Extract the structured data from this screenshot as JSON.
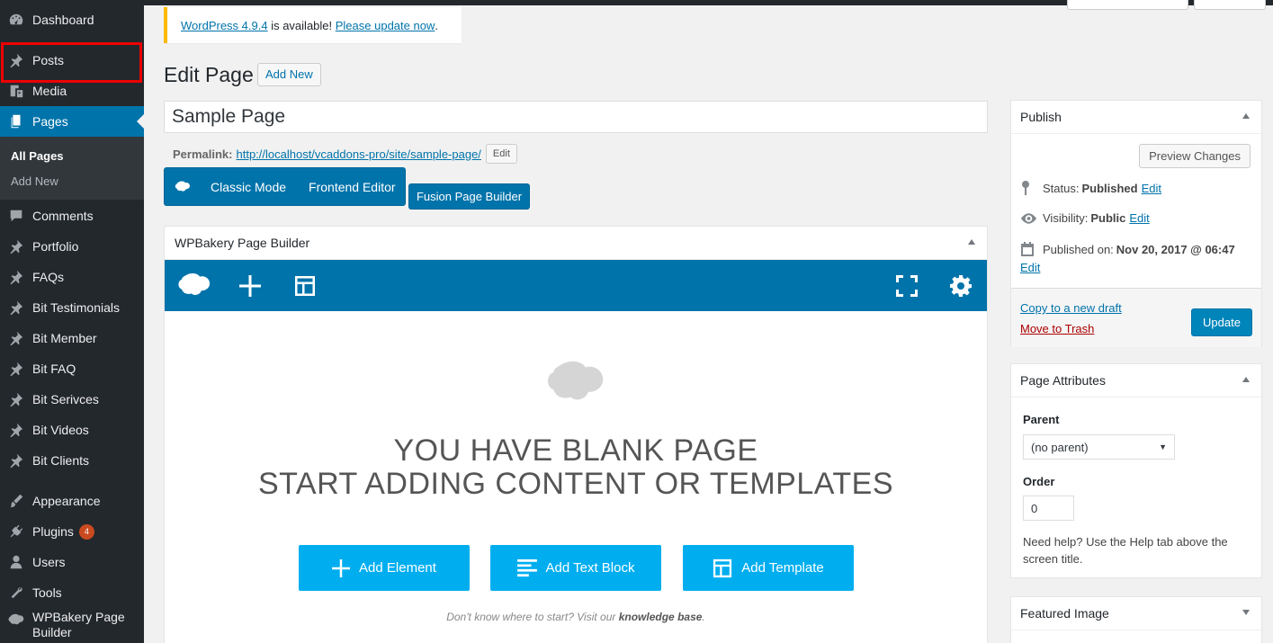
{
  "sidebar": {
    "items": [
      {
        "label": "Dashboard",
        "icon": "dashboard-icon"
      },
      {
        "label": "Posts",
        "icon": "pin-icon"
      },
      {
        "label": "Media",
        "icon": "media-icon"
      },
      {
        "label": "Pages",
        "icon": "pages-icon"
      },
      {
        "label": "Comments",
        "icon": "comments-icon"
      },
      {
        "label": "Portfolio",
        "icon": "pin-icon"
      },
      {
        "label": "FAQs",
        "icon": "pin-icon"
      },
      {
        "label": "Bit Testimonials",
        "icon": "pin-icon"
      },
      {
        "label": "Bit Member",
        "icon": "pin-icon"
      },
      {
        "label": "Bit FAQ",
        "icon": "pin-icon"
      },
      {
        "label": "Bit Serivces",
        "icon": "pin-icon"
      },
      {
        "label": "Bit Videos",
        "icon": "pin-icon"
      },
      {
        "label": "Bit Clients",
        "icon": "pin-icon"
      },
      {
        "label": "Appearance",
        "icon": "appearance-icon"
      },
      {
        "label": "Plugins",
        "icon": "plugins-icon",
        "badge": "4"
      },
      {
        "label": "Users",
        "icon": "users-icon"
      },
      {
        "label": "Tools",
        "icon": "tools-icon"
      },
      {
        "label": "WPBakery Page Builder",
        "icon": "wpbakery-icon"
      }
    ],
    "submenu": [
      "All Pages",
      "Add New"
    ]
  },
  "notice": {
    "version_link": "WordPress 4.9.4",
    "middle_text": " is available! ",
    "update_link": "Please update now",
    "end_text": "."
  },
  "heading": {
    "title": "Edit Page",
    "add_new": "Add New"
  },
  "title_input": {
    "value": "Sample Page"
  },
  "permalink": {
    "label": "Permalink:",
    "url": "http://localhost/vcaddons-pro/site/sample-page/",
    "edit": "Edit"
  },
  "mode_buttons": {
    "classic": "Classic Mode",
    "frontend": "Frontend Editor",
    "fusion": "Fusion Page Builder"
  },
  "wpbakery": {
    "box_title": "WPBakery Page Builder",
    "blank_line1": "YOU HAVE BLANK PAGE",
    "blank_line2": "START ADDING CONTENT OR TEMPLATES",
    "add_element": "Add Element",
    "add_text_block": "Add Text Block",
    "add_template": "Add Template",
    "helper_prefix": "Don't know where to start? Visit our ",
    "helper_link": "knowledge base",
    "helper_suffix": "."
  },
  "publish": {
    "title": "Publish",
    "preview": "Preview Changes",
    "status_label": "Status: ",
    "status_value": "Published",
    "visibility_label": "Visibility: ",
    "visibility_value": "Public",
    "published_label": "Published on: ",
    "published_value": "Nov 20, 2017 @ 06:47",
    "edit": "Edit",
    "copy_draft": "Copy to a new draft",
    "trash": "Move to Trash",
    "update": "Update"
  },
  "attributes": {
    "title": "Page Attributes",
    "parent_label": "Parent",
    "parent_value": "(no parent)",
    "order_label": "Order",
    "order_value": "0",
    "help": "Need help? Use the Help tab above the screen title."
  },
  "featured": {
    "title": "Featured Image"
  },
  "colors": {
    "admin_dark": "#23282d",
    "accent_blue": "#0073aa",
    "wpb_button": "#00aef0",
    "highlight_red": "#ee0000"
  }
}
